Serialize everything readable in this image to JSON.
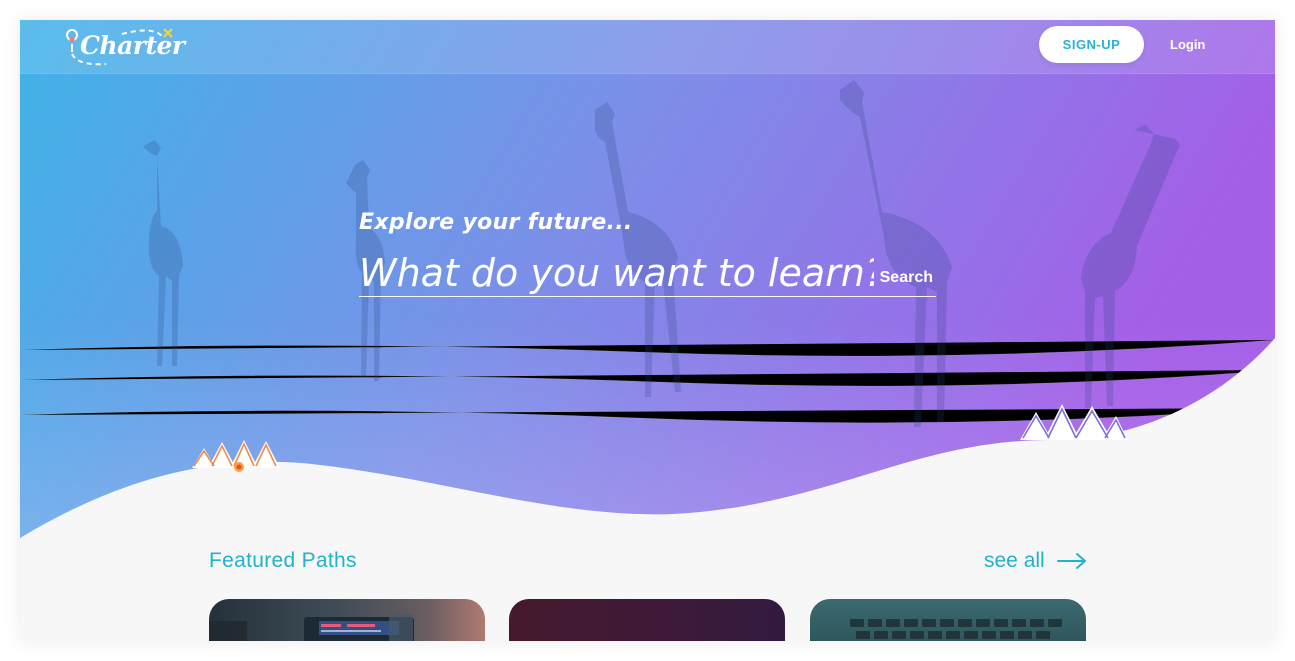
{
  "brand": {
    "name": "Charter"
  },
  "nav": {
    "signup_label": "SIGN-UP",
    "login_label": "Login"
  },
  "hero": {
    "tagline": "Explore your future...",
    "search_placeholder": "What do you want to learn?",
    "search_button": "Search"
  },
  "featured": {
    "title": "Featured Paths",
    "see_all_label": "see all",
    "cards": [
      {
        "icon": "image-thumbnail-devices"
      },
      {
        "icon": "image-thumbnail-abstract"
      },
      {
        "icon": "image-thumbnail-keyboard"
      }
    ]
  },
  "colors": {
    "accent": "#1fb3cc",
    "hero_gradient_start": "#3fb3e8",
    "hero_gradient_end": "#a45ee8",
    "background": "#f7f7f8"
  }
}
